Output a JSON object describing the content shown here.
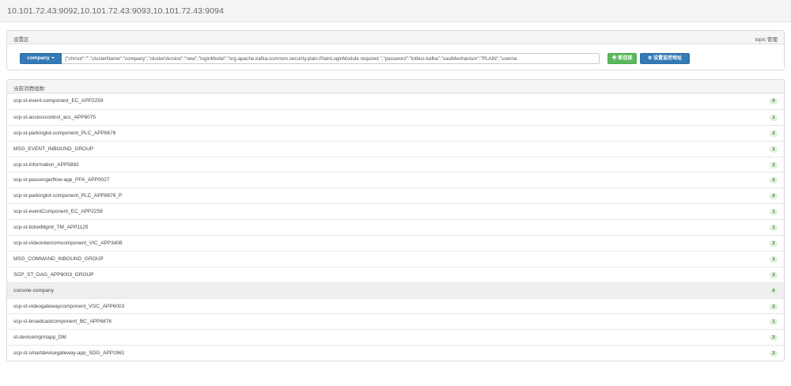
{
  "header": {
    "brokers": "10.101.72.43:9092,10.101.72.43:9093,10.101.72.43:9094"
  },
  "settings": {
    "title": "设置区",
    "topic_manage": "topic 管理",
    "cluster_button": "company",
    "config_value": "{\"chroot\":\"\",\"clusterName\":\"company\",\"clusterVersion\":\"new\",\"loginModel\":\"org.apache.kafka.common.security.plain.PlainLoginModule required \",\"password\":\"lotbus-kafka\",\"saslMechanism\":\"PLAIN\",\"userna",
    "add_label": "新连接",
    "monitor_label": "设置监控地址"
  },
  "groups": {
    "title": "当前消费组数:",
    "items": [
      {
        "name": "scp-st-event-component_EC_APP2259",
        "count": "0"
      },
      {
        "name": "scp-st-accesscontrol_acc_APP8075",
        "count": "1"
      },
      {
        "name": "scp-st-parkinglot-component_PLC_APP8676",
        "count": "2"
      },
      {
        "name": "MSG_EVENT_INBOUND_GROUP",
        "count": "1"
      },
      {
        "name": "scp-st-information_APP5892",
        "count": "2"
      },
      {
        "name": "scp-st-passengerflow-app_PFA_APP0027",
        "count": "2"
      },
      {
        "name": "scp-st-parkinglot-component_PLC_APP8676_P",
        "count": "0"
      },
      {
        "name": "scp-st-eventComponent_EC_APP2259",
        "count": "1"
      },
      {
        "name": "scp-st-ticketMgmt_TM_APP1125",
        "count": "1"
      },
      {
        "name": "scp-st-videointercomcomponent_VIC_APP3408",
        "count": "2"
      },
      {
        "name": "MSG_COMMAND_INBOUND_GROUP",
        "count": "1"
      },
      {
        "name": "SCP_ST_DAG_APP6003_GROUP",
        "count": "2"
      },
      {
        "name": "console-company",
        "count": "0",
        "active": true
      },
      {
        "name": "scp-st-videogatewaycomponent_VGC_APP6003",
        "count": "2"
      },
      {
        "name": "scp-st-broadcastcomponent_BC_APP6876",
        "count": "1"
      },
      {
        "name": "st-devicemgmtapp_DM",
        "count": "2"
      },
      {
        "name": "scp-st-smartdevicegateway-app_SDG_APP1961",
        "count": "2"
      }
    ]
  },
  "colors": {
    "primary": "#337ab7",
    "success": "#5cb85c",
    "badge_bg": "#dff0d8",
    "badge_text": "#3c763d"
  }
}
